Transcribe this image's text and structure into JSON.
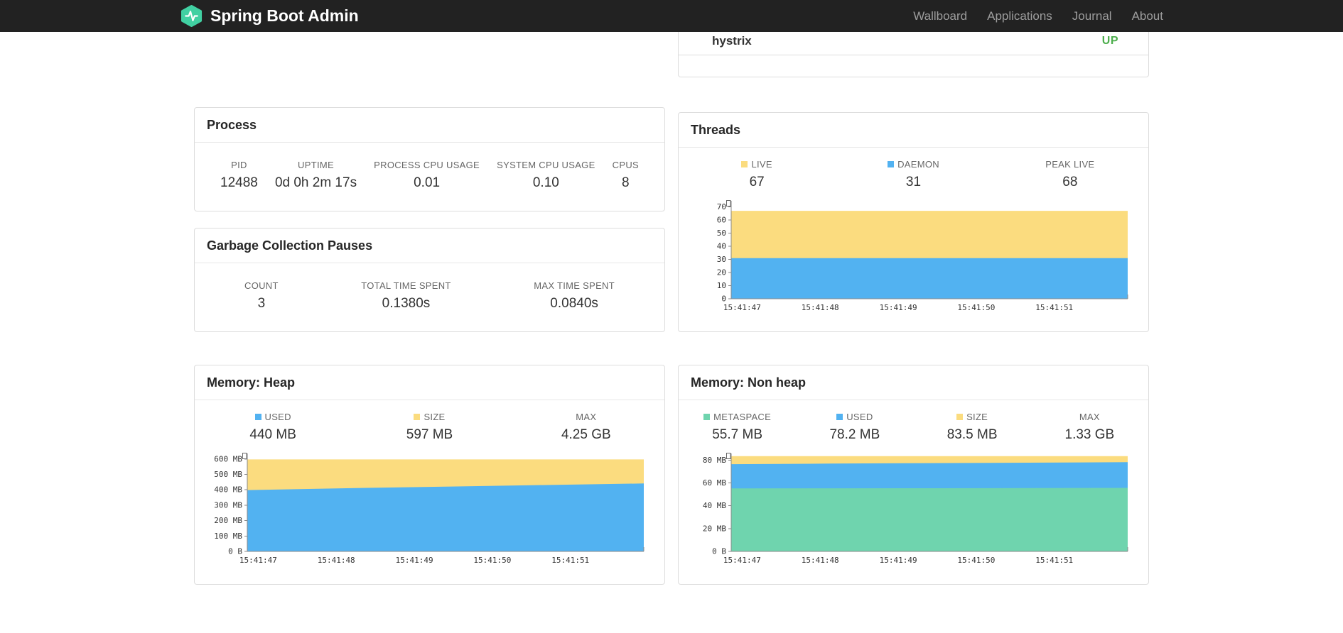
{
  "navbar": {
    "brand": "Spring Boot Admin",
    "links": [
      "Wallboard",
      "Applications",
      "Journal",
      "About"
    ]
  },
  "health": {
    "name": "hystrix",
    "status": "UP",
    "status_color": "#4cae4c"
  },
  "process": {
    "title": "Process",
    "stats": [
      {
        "label": "PID",
        "value": "12488"
      },
      {
        "label": "UPTIME",
        "value": "0d 0h 2m 17s"
      },
      {
        "label": "PROCESS CPU USAGE",
        "value": "0.01"
      },
      {
        "label": "SYSTEM CPU USAGE",
        "value": "0.10"
      },
      {
        "label": "CPUS",
        "value": "8"
      }
    ]
  },
  "gc": {
    "title": "Garbage Collection Pauses",
    "stats": [
      {
        "label": "COUNT",
        "value": "3"
      },
      {
        "label": "TOTAL TIME SPENT",
        "value": "0.1380s"
      },
      {
        "label": "MAX TIME SPENT",
        "value": "0.0840s"
      }
    ]
  },
  "threads": {
    "title": "Threads",
    "stats": [
      {
        "label": "LIVE",
        "value": "67",
        "swatch": "#fbdc7f"
      },
      {
        "label": "DAEMON",
        "value": "31",
        "swatch": "#52b2f1"
      },
      {
        "label": "PEAK LIVE",
        "value": "68"
      }
    ]
  },
  "heap": {
    "title": "Memory: Heap",
    "stats": [
      {
        "label": "USED",
        "value": "440 MB",
        "swatch": "#52b2f1"
      },
      {
        "label": "SIZE",
        "value": "597 MB",
        "swatch": "#fbdc7f"
      },
      {
        "label": "MAX",
        "value": "4.25 GB"
      }
    ]
  },
  "nonheap": {
    "title": "Memory: Non heap",
    "stats": [
      {
        "label": "METASPACE",
        "value": "55.7 MB",
        "swatch": "#6fd4ae"
      },
      {
        "label": "USED",
        "value": "78.2 MB",
        "swatch": "#52b2f1"
      },
      {
        "label": "SIZE",
        "value": "83.5 MB",
        "swatch": "#fbdc7f"
      },
      {
        "label": "MAX",
        "value": "1.33 GB"
      }
    ]
  },
  "chart_data": [
    {
      "id": "threads",
      "type": "area",
      "title": "Threads",
      "x": [
        "15:41:47",
        "15:41:48",
        "15:41:49",
        "15:41:50",
        "15:41:51"
      ],
      "ylim": [
        0,
        73
      ],
      "yticks": [
        {
          "v": 0,
          "label": "0"
        },
        {
          "v": 10,
          "label": "10"
        },
        {
          "v": 20,
          "label": "20"
        },
        {
          "v": 30,
          "label": "30"
        },
        {
          "v": 40,
          "label": "40"
        },
        {
          "v": 50,
          "label": "50"
        },
        {
          "v": 60,
          "label": "60"
        },
        {
          "v": 70,
          "label": "70"
        }
      ],
      "series": [
        {
          "name": "LIVE",
          "color": "#fbdc7f",
          "values": [
            67,
            67,
            67,
            67,
            67
          ]
        },
        {
          "name": "DAEMON",
          "color": "#52b2f1",
          "values": [
            31,
            31,
            31,
            31,
            31
          ]
        }
      ]
    },
    {
      "id": "heap",
      "type": "area",
      "title": "Memory: Heap",
      "x": [
        "15:41:47",
        "15:41:48",
        "15:41:49",
        "15:41:50",
        "15:41:51"
      ],
      "ylim": [
        0,
        622
      ],
      "yticks": [
        {
          "v": 0,
          "label": "0 B"
        },
        {
          "v": 100,
          "label": "100 MB"
        },
        {
          "v": 200,
          "label": "200 MB"
        },
        {
          "v": 300,
          "label": "300 MB"
        },
        {
          "v": 400,
          "label": "400 MB"
        },
        {
          "v": 500,
          "label": "500 MB"
        },
        {
          "v": 600,
          "label": "600 MB"
        }
      ],
      "series": [
        {
          "name": "SIZE",
          "color": "#fbdc7f",
          "values": [
            597,
            597,
            597,
            597,
            597
          ]
        },
        {
          "name": "USED",
          "color": "#52b2f1",
          "values": [
            398,
            410,
            420,
            431,
            441
          ]
        }
      ]
    },
    {
      "id": "nonheap",
      "type": "area",
      "title": "Memory: Non heap",
      "x": [
        "15:41:47",
        "15:41:48",
        "15:41:49",
        "15:41:50",
        "15:41:51"
      ],
      "ylim": [
        0,
        84
      ],
      "yticks": [
        {
          "v": 0,
          "label": "0 B"
        },
        {
          "v": 20,
          "label": "20 MB"
        },
        {
          "v": 40,
          "label": "40 MB"
        },
        {
          "v": 60,
          "label": "60 MB"
        },
        {
          "v": 80,
          "label": "80 MB"
        }
      ],
      "series": [
        {
          "name": "SIZE",
          "color": "#fbdc7f",
          "values": [
            83.5,
            83.5,
            83.5,
            83.5,
            83.5
          ]
        },
        {
          "name": "USED",
          "color": "#52b2f1",
          "values": [
            76.5,
            77,
            77.4,
            77.8,
            78.2
          ]
        },
        {
          "name": "METASPACE",
          "color": "#6fd4ae",
          "values": [
            55.2,
            55.3,
            55.4,
            55.5,
            55.7
          ]
        }
      ]
    }
  ]
}
